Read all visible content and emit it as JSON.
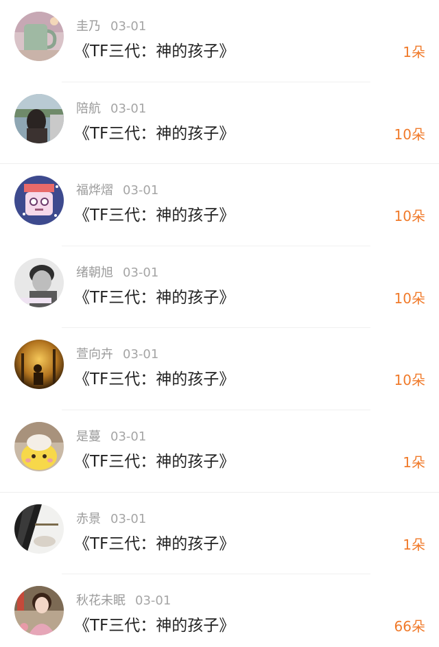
{
  "colors": {
    "accent": "#f07a2a",
    "name_gray": "#9b9b9b",
    "title_dark": "#222222"
  },
  "rows": [
    {
      "name": "圭乃",
      "date": "03-01",
      "title": "《TF三代：神的孩子》",
      "count": "1朵",
      "avatar_icon": "avatar-mug-photo"
    },
    {
      "name": "陪航",
      "date": "03-01",
      "title": "《TF三代：神的孩子》",
      "count": "10朵",
      "avatar_icon": "avatar-person-car-photo"
    },
    {
      "name": "福烨熠",
      "date": "03-01",
      "title": "《TF三代：神的孩子》",
      "count": "10朵",
      "avatar_icon": "avatar-cartoon-face"
    },
    {
      "name": "绪朝旭",
      "date": "03-01",
      "title": "《TF三代：神的孩子》",
      "count": "10朵",
      "avatar_icon": "avatar-boy-photo"
    },
    {
      "name": "萱向卉",
      "date": "03-01",
      "title": "《TF三代：神的孩子》",
      "count": "10朵",
      "avatar_icon": "avatar-silhouette-photo"
    },
    {
      "name": "是蔓",
      "date": "03-01",
      "title": "《TF三代：神的孩子》",
      "count": "1朵",
      "avatar_icon": "avatar-yellow-chick"
    },
    {
      "name": "赤景",
      "date": "03-01",
      "title": "《TF三代：神的孩子》",
      "count": "1朵",
      "avatar_icon": "avatar-dark-hair-photo"
    },
    {
      "name": "秋花未眠",
      "date": "03-01",
      "title": "《TF三代：神的孩子》",
      "count": "66朵",
      "avatar_icon": "avatar-girl-photo"
    }
  ]
}
